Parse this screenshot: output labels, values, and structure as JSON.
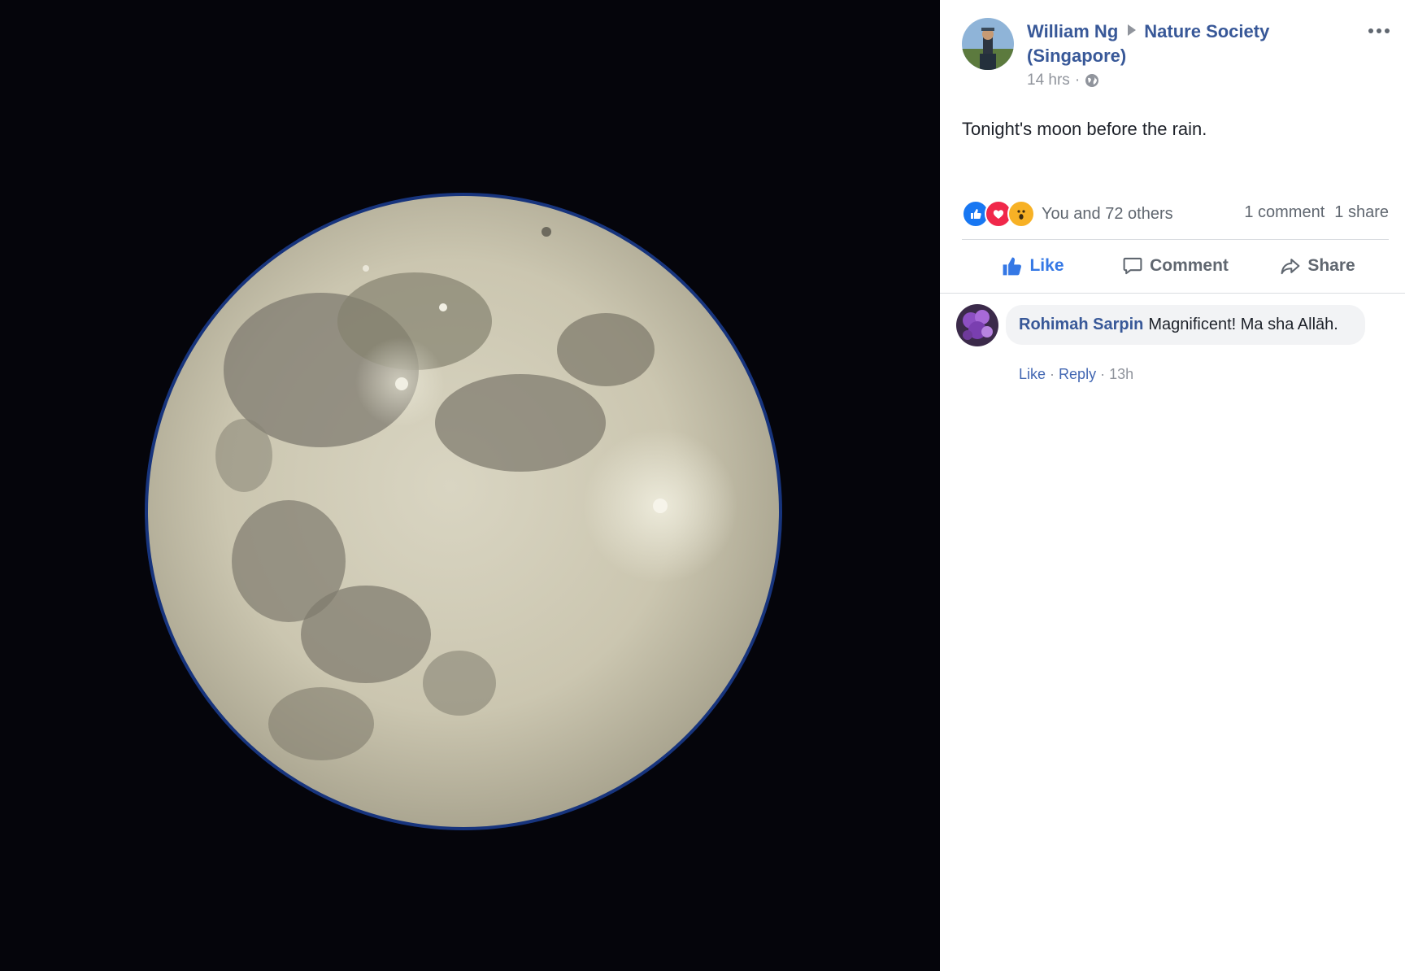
{
  "photo": {
    "subject": "full-moon",
    "background": "#000000"
  },
  "post": {
    "author": "William Ng",
    "group": "Nature Society (Singapore)",
    "time": "14 hrs",
    "privacy_icon": "globe-icon",
    "text": "Tonight's moon before the rain."
  },
  "reactions": {
    "icons": [
      "like-reaction-icon",
      "love-reaction-icon",
      "wow-reaction-icon"
    ],
    "summary": "You and 72 others",
    "comments_count": "1 comment",
    "shares_count": "1 share"
  },
  "actions": {
    "like": "Like",
    "comment": "Comment",
    "share": "Share"
  },
  "comments": [
    {
      "author": "Rohimah Sarpin",
      "text": "Magnificent! Ma sha Allāh.",
      "like": "Like",
      "reply": "Reply",
      "time": "13h"
    }
  ],
  "colors": {
    "link_blue": "#385898",
    "like_blue": "#3578e5",
    "meta_gray": "#90949c",
    "bubble_gray": "#f2f3f5"
  }
}
